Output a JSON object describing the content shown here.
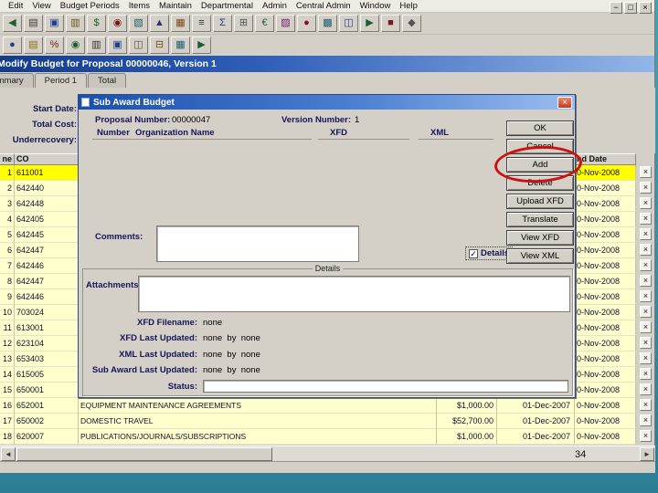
{
  "colors": {
    "annotation_red": "#cc1111",
    "selected_row": "#ffff00",
    "row_bg": "#ffffce",
    "titlebar": "#123c8c"
  },
  "menu": {
    "items": [
      "Edit",
      "View",
      "Budget Periods",
      "Items",
      "Maintain",
      "Departmental",
      "Admin",
      "Central Admin",
      "Window",
      "Help"
    ]
  },
  "toolbar": {
    "row1": [
      {
        "name": "back-icon",
        "glyph": "◀",
        "color": "#1e5e2e"
      },
      {
        "name": "report-icon",
        "glyph": "▤",
        "color": "#3a3a3a"
      },
      {
        "name": "save-icon",
        "glyph": "▣",
        "color": "#1c3f8f"
      },
      {
        "name": "copy-icon",
        "glyph": "▥",
        "color": "#6b5212"
      },
      {
        "name": "money-icon",
        "glyph": "$",
        "color": "#1e5e2e"
      },
      {
        "name": "user-icon",
        "glyph": "◉",
        "color": "#7a1a1a"
      },
      {
        "name": "chart-icon",
        "glyph": "▧",
        "color": "#1a5e6b"
      },
      {
        "name": "up-icon",
        "glyph": "▲",
        "color": "#2f2f7a"
      },
      {
        "name": "calendar-icon",
        "glyph": "▦",
        "color": "#7a4a12"
      },
      {
        "name": "list-icon",
        "glyph": "≡",
        "color": "#333333"
      },
      {
        "name": "sum-icon",
        "glyph": "Σ",
        "color": "#1c3f8f"
      },
      {
        "name": "calculator-icon",
        "glyph": "⊞",
        "color": "#555555"
      },
      {
        "name": "euro-icon",
        "glyph": "€",
        "color": "#1e5e2e"
      },
      {
        "name": "pattern-icon",
        "glyph": "▨",
        "color": "#6b1a6b"
      },
      {
        "name": "record-icon",
        "glyph": "●",
        "color": "#8a1111"
      },
      {
        "name": "dense-grid-icon",
        "glyph": "▩",
        "color": "#1a5e6b"
      },
      {
        "name": "columns-icon",
        "glyph": "◫",
        "color": "#333399"
      },
      {
        "name": "forward-icon",
        "glyph": "▶",
        "color": "#1e5e2e"
      },
      {
        "name": "stop-icon",
        "glyph": "■",
        "color": "#7a1a1a"
      },
      {
        "name": "exit-icon",
        "glyph": "◆",
        "color": "#555555"
      }
    ],
    "row2": [
      {
        "name": "globe-icon",
        "glyph": "●",
        "color": "#1c3f8f"
      },
      {
        "name": "note-icon",
        "glyph": "▤",
        "color": "#8a6d12"
      },
      {
        "name": "percent-icon",
        "glyph": "%",
        "color": "#7a1a1a"
      },
      {
        "name": "refresh-icon",
        "glyph": "◉",
        "color": "#1e5e2e"
      },
      {
        "name": "sheet-icon",
        "glyph": "▥",
        "color": "#333333"
      },
      {
        "name": "disk-icon",
        "glyph": "▣",
        "color": "#1c3f8f"
      },
      {
        "name": "window-icon",
        "glyph": "◫",
        "color": "#555555"
      },
      {
        "name": "collapse-icon",
        "glyph": "⊟",
        "color": "#6b5212"
      },
      {
        "name": "grid-icon",
        "glyph": "▦",
        "color": "#1a5e6b"
      },
      {
        "name": "go-icon",
        "glyph": "▶",
        "color": "#1e5e2e"
      }
    ]
  },
  "window": {
    "title": "Modify Budget for Proposal 00000046, Version 1",
    "controls": [
      {
        "name": "minimize-icon",
        "glyph": "−"
      },
      {
        "name": "restore-icon",
        "glyph": "□"
      },
      {
        "name": "close-icon",
        "glyph": "×"
      }
    ]
  },
  "tabs": [
    {
      "label": "Summary",
      "active": false
    },
    {
      "label": "Period 1",
      "active": true
    },
    {
      "label": "Total",
      "active": false
    }
  ],
  "form": {
    "fields": [
      {
        "label": "Start Date:"
      },
      {
        "label": "Total Cost:"
      },
      {
        "label": "Underrecovery:"
      }
    ]
  },
  "table": {
    "header": {
      "line": "ne",
      "cost": "CO",
      "end_date": "nd Date"
    },
    "delete_glyph": "×",
    "rows": [
      {
        "n": "1",
        "code": "611001",
        "end": "0-Nov-2008",
        "selected": true
      },
      {
        "n": "2",
        "code": "642440",
        "end": "0-Nov-2008"
      },
      {
        "n": "3",
        "code": "642448",
        "end": "0-Nov-2008"
      },
      {
        "n": "4",
        "code": "642405",
        "end": "0-Nov-2008"
      },
      {
        "n": "5",
        "code": "642445",
        "end": "0-Nov-2008"
      },
      {
        "n": "6",
        "code": "642447",
        "end": "0-Nov-2008"
      },
      {
        "n": "7",
        "code": "642446",
        "end": "0-Nov-2008"
      },
      {
        "n": "8",
        "code": "642447",
        "end": "0-Nov-2008"
      },
      {
        "n": "9",
        "code": "642446",
        "end": "0-Nov-2008"
      },
      {
        "n": "10",
        "code": "703024",
        "end": "0-Nov-2008"
      },
      {
        "n": "11",
        "code": "613001",
        "end": "0-Nov-2008"
      },
      {
        "n": "12",
        "code": "623104",
        "end": "0-Nov-2008"
      },
      {
        "n": "13",
        "code": "653403",
        "end": "0-Nov-2008"
      },
      {
        "n": "14",
        "code": "615005",
        "end": "0-Nov-2008"
      },
      {
        "n": "15",
        "code": "650001",
        "end": "0-Nov-2008"
      },
      {
        "n": "16",
        "code": "652001",
        "desc": "EQUIPMENT MAINTENANCE AGREEMENTS",
        "amount": "$1,000.00",
        "start": "01-Dec-2007",
        "end": "0-Nov-2008"
      },
      {
        "n": "17",
        "code": "650002",
        "desc": "DOMESTIC TRAVEL",
        "amount": "$52,700.00",
        "start": "01-Dec-2007",
        "end": "0-Nov-2008"
      },
      {
        "n": "18",
        "code": "620007",
        "desc": "PUBLICATIONS/JOURNALS/SUBSCRIPTIONS",
        "amount": "$1,000.00",
        "start": "01-Dec-2007",
        "end": "0-Nov-2008"
      }
    ]
  },
  "dialog": {
    "title": "Sub Award Budget",
    "close_glyph": "×",
    "check_glyph": "✓",
    "proposal_label": "Proposal Number:",
    "proposal_value": "00000047",
    "version_label": "Version Number:",
    "version_value": "1",
    "columns": [
      "Number",
      "Organization Name",
      "XFD",
      "XML"
    ],
    "buttons": [
      {
        "label": "OK"
      },
      {
        "label": "Cancel"
      },
      {
        "label": "Add",
        "circled": true
      },
      {
        "label": "Delete"
      },
      {
        "label": "Upload XFD"
      },
      {
        "label": "Translate"
      },
      {
        "label": "View XFD"
      },
      {
        "label": "View XML"
      }
    ],
    "comments_label": "Comments:",
    "details_checkbox_label": "Details",
    "details_group_label": "Details",
    "attachments_label": "Attachments:",
    "meta": [
      {
        "label": "XFD Filename:",
        "value": "none"
      },
      {
        "label": "XFD Last Updated:",
        "value": "none  by  none"
      },
      {
        "label": "XML Last Updated:",
        "value": "none  by  none"
      },
      {
        "label": "Sub Award Last Updated:",
        "value": "none  by  none"
      },
      {
        "label": "Status:",
        "value": "",
        "box": true
      }
    ]
  },
  "scrollbar": {
    "left": "◄",
    "right": "►"
  },
  "statusbar": {
    "page": "34"
  }
}
